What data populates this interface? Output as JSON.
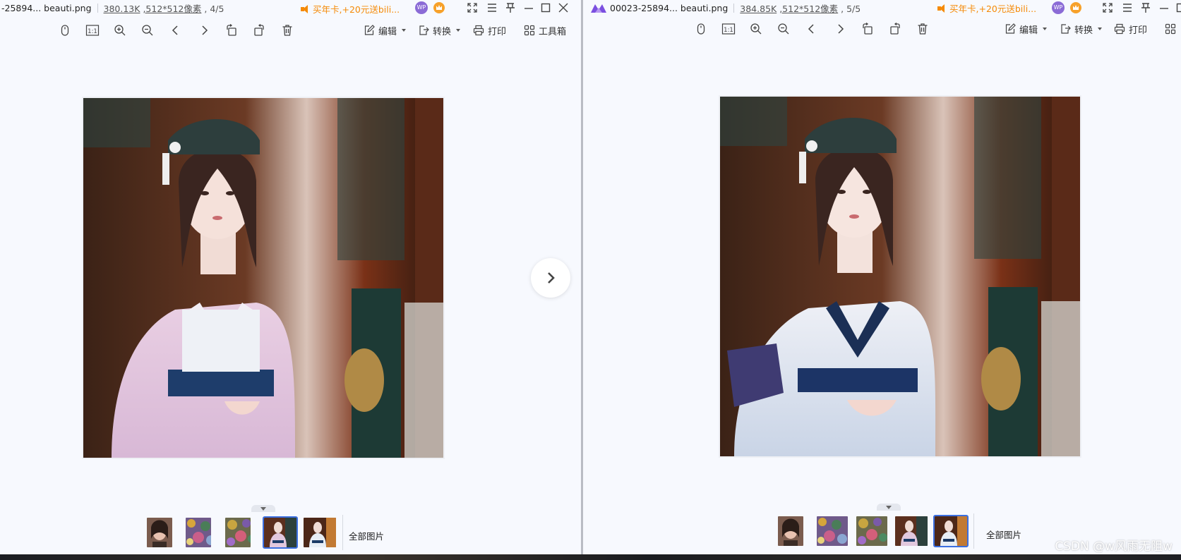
{
  "left": {
    "file_name": "-25894... beauti.png",
    "file_size": "380.13K",
    "dimensions": ",512*512像素",
    "position": ", 4/5",
    "promo": "买年卡,+20元送bili...",
    "toolbar": {
      "edit": "编辑",
      "convert": "转换",
      "print": "打印",
      "toolbox": "工具箱"
    },
    "all_images": "全部图片"
  },
  "right": {
    "file_name": "00023-25894... beauti.png",
    "file_size": "384.85K",
    "dimensions": ",512*512像素",
    "position": ", 5/5",
    "promo": "买年卡,+20元送bili...",
    "toolbar": {
      "edit": "编辑",
      "convert": "转换",
      "print": "打印"
    },
    "all_images": "全部图片"
  },
  "badge_wp": "WP",
  "zoom_actual": "1:1",
  "watermark": "CSDN @w风雨无阻w",
  "colors": {
    "accent": "#3b6fe0",
    "promo": "#f58a07",
    "background": "#f7f9fe"
  }
}
